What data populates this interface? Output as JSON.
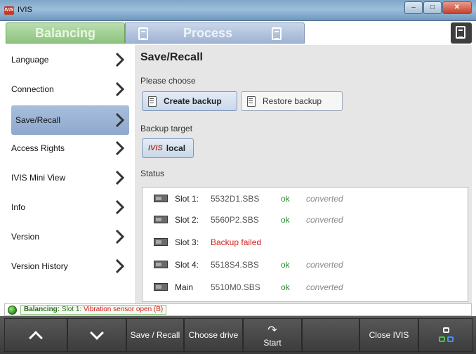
{
  "window": {
    "title": "IVIS",
    "icon": "ivis-app-icon",
    "controls": [
      "minimize-icon",
      "maximize-icon",
      "close-icon"
    ]
  },
  "tabs": {
    "balancing": "Balancing",
    "process": "Process"
  },
  "sidebar": {
    "items": [
      {
        "label": "Language"
      },
      {
        "label": "Connection"
      },
      {
        "label": "Save/Recall",
        "active": true
      },
      {
        "label": "Access Rights"
      },
      {
        "label": "IVIS Mini View"
      },
      {
        "label": "Info"
      },
      {
        "label": "Version"
      },
      {
        "label": "Version History"
      }
    ]
  },
  "main": {
    "title": "Save/Recall",
    "choose_label": "Please choose",
    "create_backup": "Create backup",
    "restore_backup": "Restore backup",
    "target_label": "Backup target",
    "target_logo": "IVIS",
    "target_value": "local",
    "status_label": "Status",
    "slots": [
      {
        "name": "Slot 1:",
        "file": "5532D1.SBS",
        "ok": "ok",
        "state": "converted"
      },
      {
        "name": "Slot 2:",
        "file": "5560P2.SBS",
        "ok": "ok",
        "state": "converted"
      },
      {
        "name": "Slot 3:",
        "error": "Backup failed"
      },
      {
        "name": "Slot 4:",
        "file": "5518S4.SBS",
        "ok": "ok",
        "state": "converted"
      },
      {
        "name": "Main",
        "file": "5510M0.SBS",
        "ok": "ok",
        "state": "converted"
      }
    ]
  },
  "statusline": {
    "prefix": "Balancing:",
    "slot": "Slot 1:",
    "message": "Vibration sensor open (B)"
  },
  "toolbar": {
    "save_recall": "Save / Recall",
    "choose_drive": "Choose drive",
    "start": "Start",
    "close": "Close IVIS"
  },
  "colors": {
    "accent_green": "#8dc37e",
    "accent_blue": "#9fb3d3",
    "error_red": "#d42020",
    "ok_green": "#2a8c2a"
  }
}
